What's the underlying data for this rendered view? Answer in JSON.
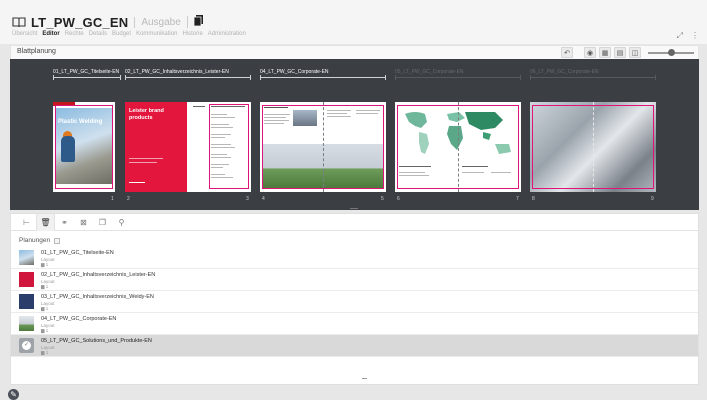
{
  "header": {
    "title": "LT_PW_GC_EN",
    "issue_label": "Ausgabe",
    "nav": [
      "Übersicht",
      "Editor",
      "Rechte",
      "Details",
      "Budget",
      "Kommunikation",
      "Historie",
      "Administration"
    ],
    "active_nav": "Editor",
    "icons": [
      "book-icon",
      "stack-icon",
      "expand-icon",
      "more-icon"
    ]
  },
  "planning_bar": {
    "label": "Blattplanung",
    "tool_icons": [
      "undo-icon",
      "eye-icon",
      "grid-icon",
      "page-icon",
      "layers-icon",
      "zoom-slider"
    ]
  },
  "board": {
    "sections": [
      {
        "label": "01_LT_PW_GC_Titelseite-EN",
        "active": true
      },
      {
        "label": "02_LT_PW_GC_Inhaltsverzeichnis_Leister-EN",
        "active": true
      },
      {
        "label": "04_LT_PW_GC_Corporate-EN",
        "active": true
      },
      {
        "label": "05_LT_PW_GC_Corporate-EN",
        "active": false
      },
      {
        "label": "06_LT_PW_GC_Corporate-EN",
        "active": false
      }
    ],
    "page_numbers": [
      "1",
      "2",
      "3",
      "4",
      "5",
      "6",
      "7",
      "8",
      "9"
    ],
    "cover_title": "Plastic Welding",
    "red_page_title": "Leister brand products"
  },
  "lower": {
    "tab_icons": [
      "tree-icon",
      "trash-icon",
      "link-icon",
      "image-icon",
      "copy-icon",
      "search-icon"
    ],
    "plan_heading": "Planungen",
    "plans": [
      {
        "name": "01_LT_PW_GC_Titelseite-EN",
        "type": "Layout",
        "count": "1",
        "selected": false
      },
      {
        "name": "02_LT_PW_GC_Inhaltsverzeichnis_Leister-EN",
        "type": "Layout",
        "count": "1",
        "selected": false
      },
      {
        "name": "03_LT_PW_GC_Inhaltsverzeichnis_Weldy-EN",
        "type": "Layout",
        "count": "1",
        "selected": false
      },
      {
        "name": "04_LT_PW_GC_Corporate-EN",
        "type": "Layout",
        "count": "1",
        "selected": false
      },
      {
        "name": "05_LT_PW_GC_Solutions_und_Produkte-EN",
        "type": "Layout",
        "count": "1",
        "selected": true
      }
    ]
  },
  "fab_icon": "edit-icon"
}
